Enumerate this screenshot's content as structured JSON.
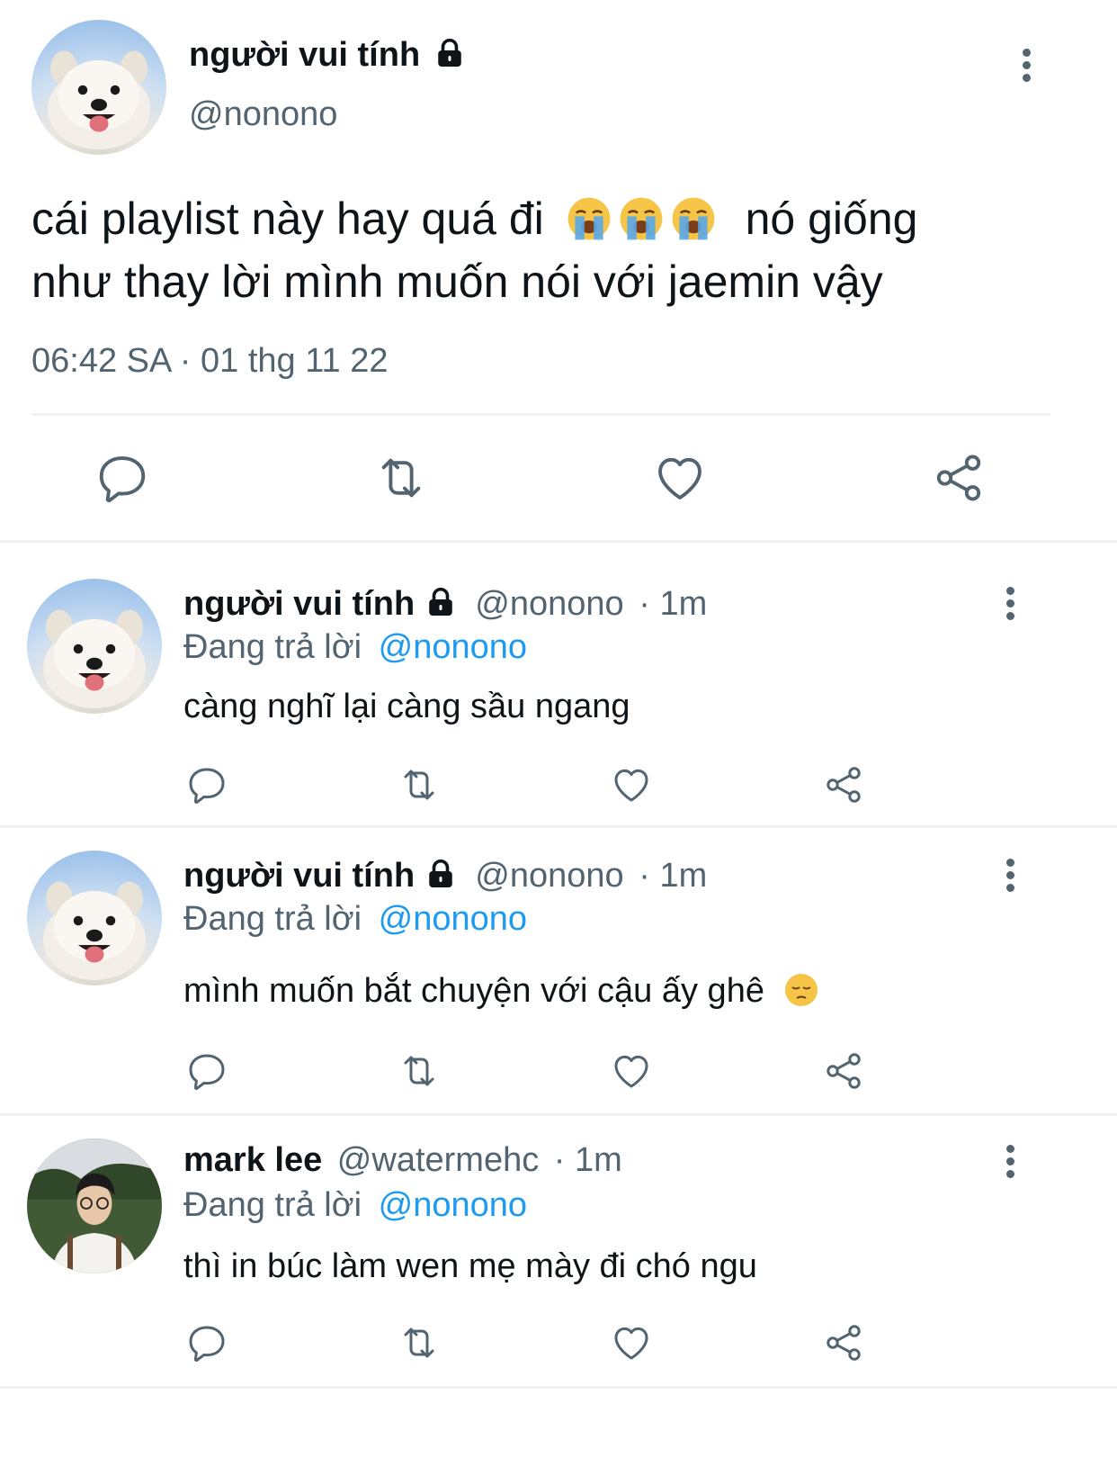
{
  "main_tweet": {
    "display_name": "người vui tính",
    "handle": "@nonono",
    "text_line1": "cái playlist này hay quá đi",
    "text_line1_after": "nó giống",
    "text_line2": "như thay lời mình muốn nói với jaemin vậy",
    "timestamp": "06:42 SA · 01 thg 11 22"
  },
  "replies": [
    {
      "display_name": "người vui tính",
      "handle": "@nonono",
      "time": "· 1m",
      "replying_prefix": "Đang trả lời",
      "replying_to": "@nonono",
      "text": "càng nghĩ lại càng sầu ngang"
    },
    {
      "display_name": "người vui tính",
      "handle": "@nonono",
      "time": "· 1m",
      "replying_prefix": "Đang trả lời",
      "replying_to": "@nonono",
      "text": "mình muốn bắt chuyện với cậu ấy ghê"
    },
    {
      "display_name": "mark lee",
      "handle": "@watermehc",
      "time": "· 1m",
      "replying_prefix": "Đang trả lời",
      "replying_to": "@nonono",
      "text": "thì in búc làm wen mẹ mày đi chó ngu"
    }
  ],
  "colors": {
    "text": "#0f1419",
    "muted": "#536471",
    "link": "#1d9bf0",
    "divider": "#eff1f3"
  },
  "icons": {
    "reply": "reply-icon",
    "retweet": "retweet-icon",
    "like": "heart-icon",
    "share": "share-icon",
    "more": "kebab-icon",
    "lock": "lock-icon",
    "crying": "loudly-crying-face-emoji",
    "pensive": "pensive-face-emoji"
  }
}
